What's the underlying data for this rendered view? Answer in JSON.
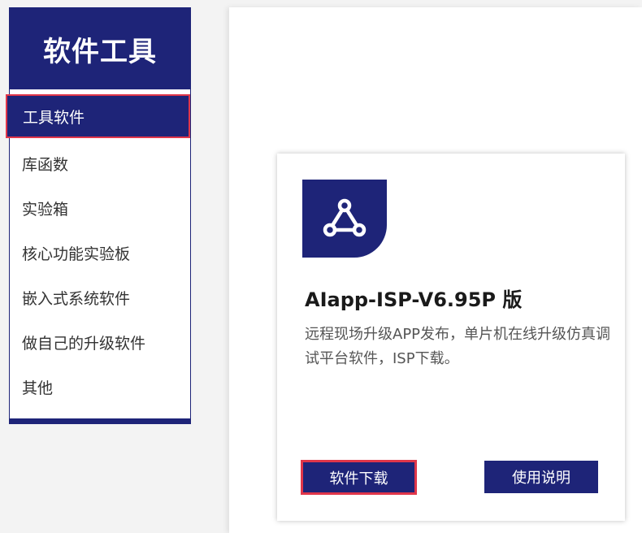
{
  "sidebar": {
    "title": "软件工具",
    "items": [
      {
        "label": "工具软件",
        "active": true
      },
      {
        "label": "库函数"
      },
      {
        "label": "实验箱"
      },
      {
        "label": "核心功能实验板"
      },
      {
        "label": "嵌入式系统软件"
      },
      {
        "label": "做自己的升级软件"
      },
      {
        "label": "其他"
      }
    ]
  },
  "card": {
    "icon": "share-network-icon",
    "title": "AIapp-ISP-V6.95P 版",
    "description": "远程现场升级APP发布，单片机在线升级仿真调试平台软件，ISP下载。",
    "download_label": "软件下载",
    "manual_label": "使用说明"
  },
  "colors": {
    "brand": "#1e2478",
    "highlight": "#e0364a"
  }
}
